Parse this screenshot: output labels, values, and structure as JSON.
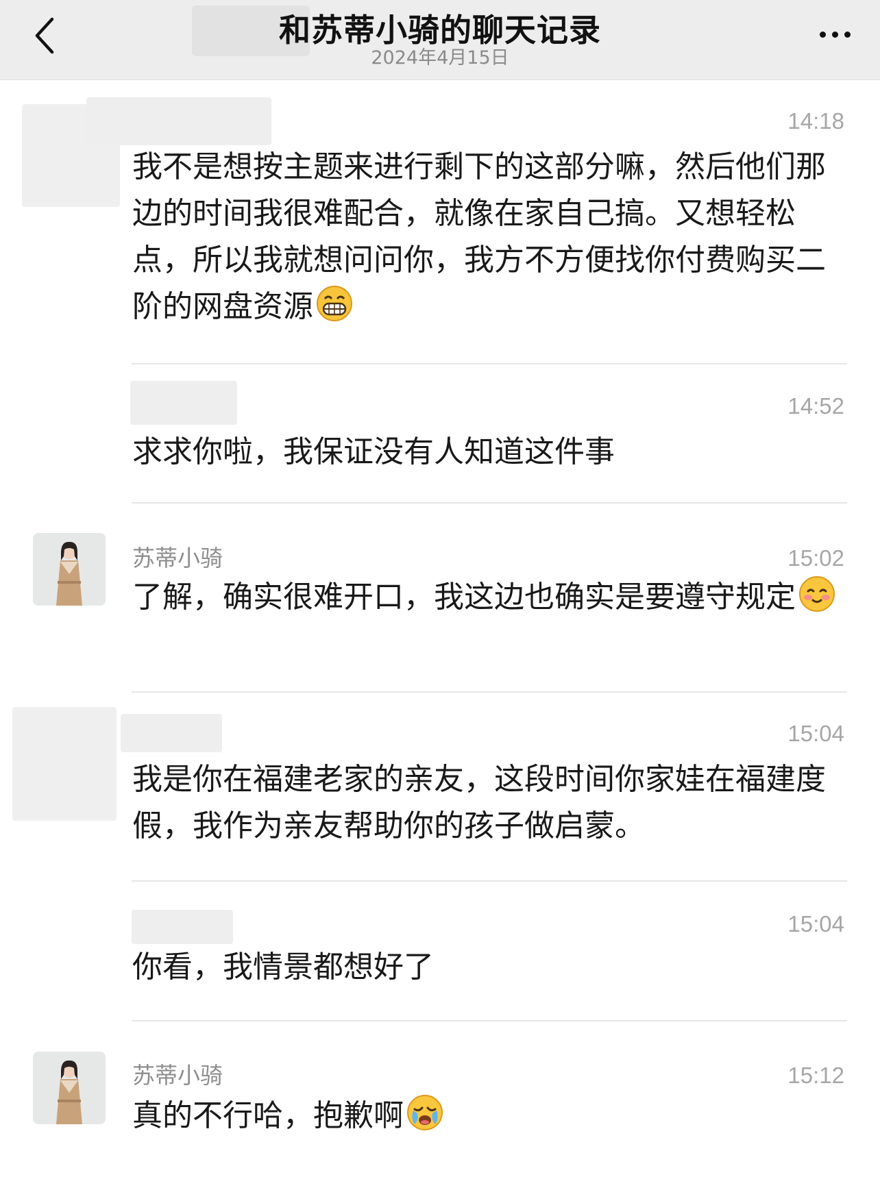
{
  "header": {
    "title": "和苏蒂小骑的聊天记录",
    "subtitle": "2024年4月15日"
  },
  "messages": [
    {
      "sender": "",
      "time": "14:18",
      "text": "我不是想按主题来进行剩下的这部分嘛，然后他们那边的时间我很难配合，就像在家自己搞。又想轻松点，所以我就想问问你，我方不方便找你付费购买二阶的网盘资源",
      "emoji": "grinning-face-emoji"
    },
    {
      "sender": "",
      "time": "14:52",
      "text": "求求你啦，我保证没有人知道这件事",
      "emoji": ""
    },
    {
      "sender": "苏蒂小骑",
      "time": "15:02",
      "text": "了解，确实很难开口，我这边也确实是要遵守规定",
      "emoji": "smiling-face-emoji"
    },
    {
      "sender": "",
      "time": "15:04",
      "text": "我是你在福建老家的亲友，这段时间你家娃在福建度假，我作为亲友帮助你的孩子做启蒙。",
      "emoji": ""
    },
    {
      "sender": "",
      "time": "15:04",
      "text": "你看，我情景都想好了",
      "emoji": ""
    },
    {
      "sender": "苏蒂小骑",
      "time": "15:12",
      "text": "真的不行哈，抱歉啊",
      "emoji": "crying-face-emoji"
    }
  ],
  "colors": {
    "header_bg": "#ededed",
    "text": "#191919",
    "muted": "#a6a6a6",
    "avatar_coat": "#c8a27a"
  }
}
